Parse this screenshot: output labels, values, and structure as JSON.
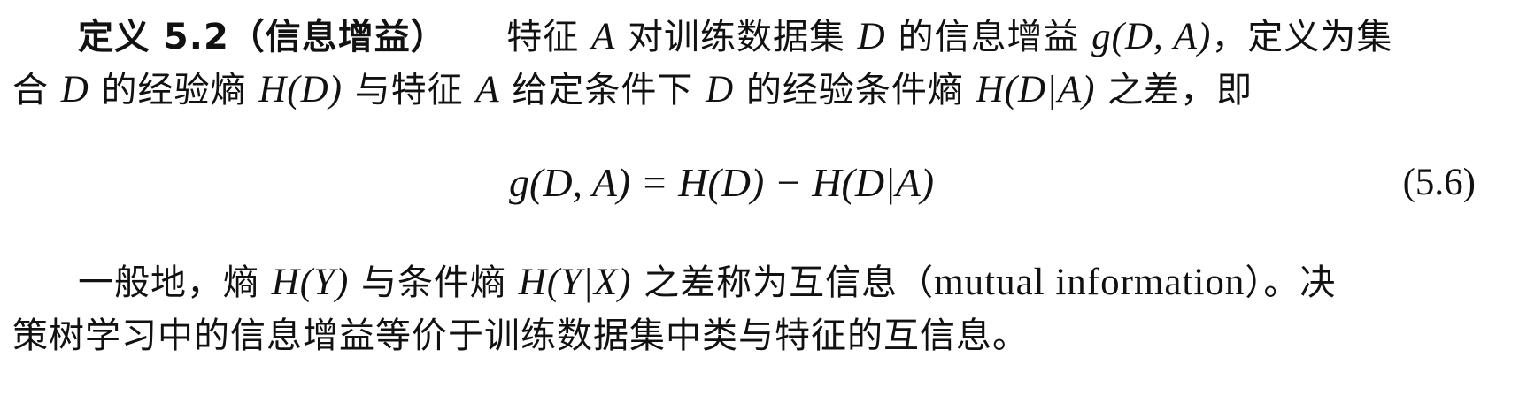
{
  "definition": {
    "label": "定义 5.2",
    "name": "（信息增益）",
    "line1_a": "特征",
    "line1_b": "对训练数据集",
    "line1_c": "的信息增益",
    "line1_d": "，定义为集",
    "line2_a": "合",
    "line2_b": "的经验熵",
    "line2_c": "与特征",
    "line2_d": "给定条件下",
    "line2_e": "的经验条件熵",
    "line2_f": "之差，即"
  },
  "equation": {
    "text": "g(D, A) = H(D) − H(D|A)",
    "number": "(5.6)"
  },
  "paragraph": {
    "line1_a": "一般地，熵",
    "line1_b": "与条件熵",
    "line1_c": "之差称为互信息（",
    "line1_d": "mutual information",
    "line1_e": "）。决",
    "line2": "策树学习中的信息增益等价于训练数据集中类与特征的互信息。"
  },
  "symbols": {
    "A": "A",
    "D": "D",
    "gDA": "g(D, A)",
    "HD": "H(D)",
    "HDA": "H(D|A)",
    "HY": "H(Y)",
    "HYX": "H(Y|X)"
  }
}
